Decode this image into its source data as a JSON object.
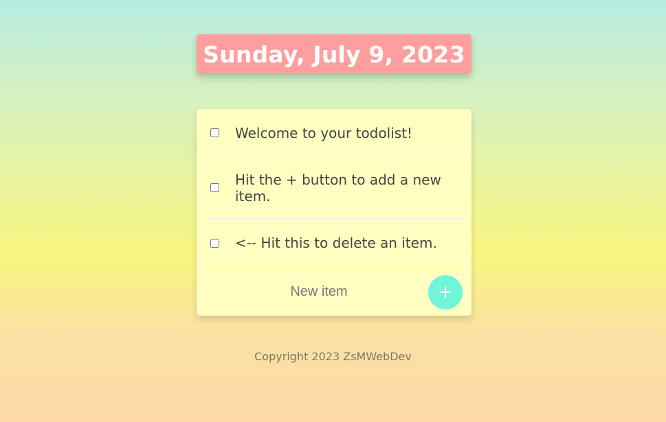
{
  "heading": {
    "title": "Sunday, July 9, 2023"
  },
  "todo": {
    "items": [
      {
        "text": "Welcome to your todolist!",
        "checked": false
      },
      {
        "text": "Hit the + button to add a new item.",
        "checked": false
      },
      {
        "text": "<-- Hit this to delete an item.",
        "checked": false
      }
    ],
    "new_item": {
      "placeholder": "New item",
      "value": ""
    },
    "add_button_label": "+"
  },
  "footer": {
    "copyright": "Copyright 2023 ZsMWebDev"
  },
  "colors": {
    "heading_bg": "#ff9e9e",
    "card_bg": "#ffffc2",
    "accent": "#6ff5d8"
  }
}
